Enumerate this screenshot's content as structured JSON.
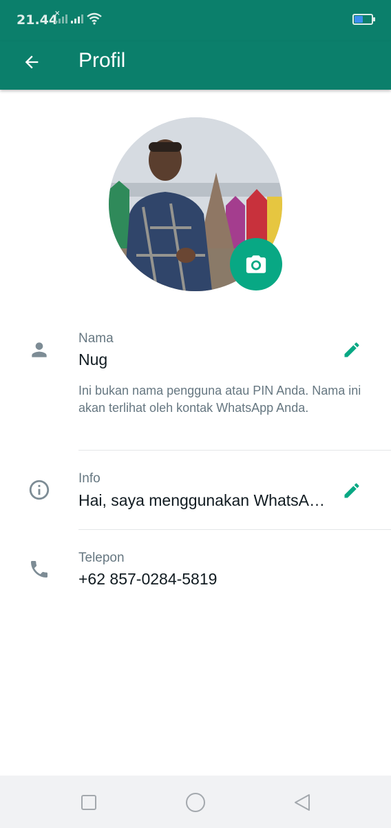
{
  "status_bar": {
    "time": "21.44"
  },
  "app_bar": {
    "title": "Profil",
    "back_icon": "arrow-left-icon"
  },
  "profile": {
    "photo_alt": "Profile photo",
    "camera_icon": "camera-icon",
    "name_label": "Nama",
    "name_value": "Nug",
    "name_help": "Ini bukan nama pengguna atau PIN Anda. Nama ini akan terlihat oleh kontak WhatsApp Anda.",
    "info_label": "Info",
    "info_value": "Hai, saya menggunakan WhatsA…",
    "phone_label": "Telepon",
    "phone_value": "+62 857-0284-5819"
  },
  "colors": {
    "primary": "#0b7f6b",
    "accent": "#08a884",
    "label": "#667781"
  },
  "nav_bar": {
    "buttons": [
      "recents-square-icon",
      "home-circle-icon",
      "back-triangle-icon"
    ]
  }
}
